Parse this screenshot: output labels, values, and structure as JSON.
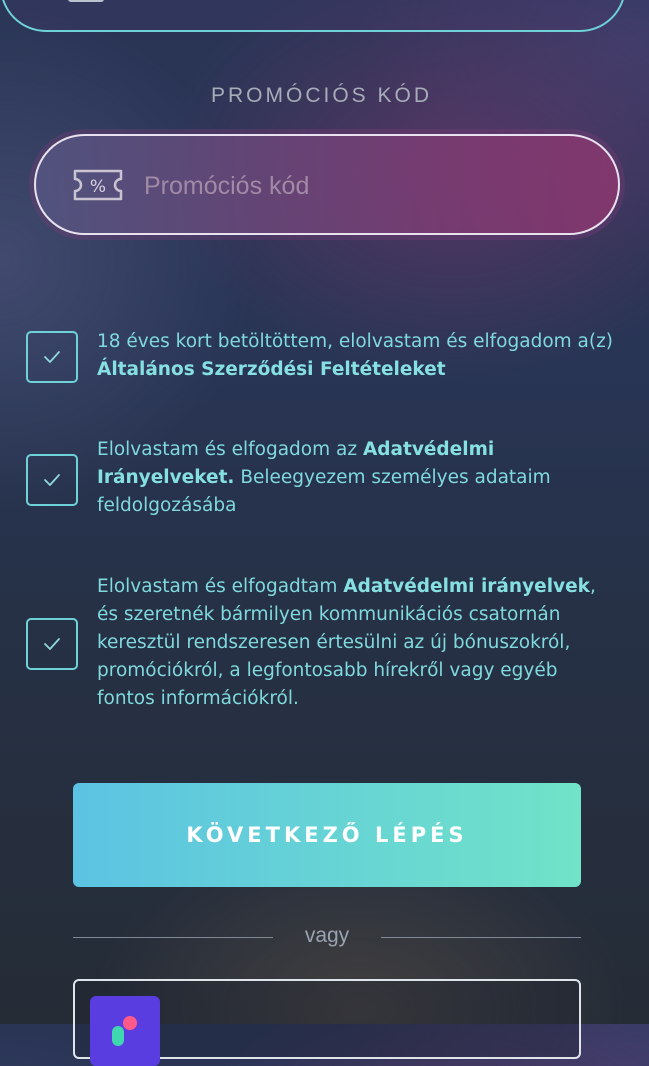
{
  "promo": {
    "section_label": "PROMÓCIÓS KÓD",
    "placeholder": "Promóciós kód",
    "icon": "ticket-percent-icon"
  },
  "consents": [
    {
      "checked": true,
      "text_before": "18 éves kort betöltöttem, elolvastam és elfogadom a(z) ",
      "link": "Általános Szerződési Feltételeket",
      "text_after": ""
    },
    {
      "checked": true,
      "text_before": "Elolvastam és elfogadom az ",
      "link": "Adatvédelmi Irányelveket.",
      "text_after": " Beleegyezem személyes adataim feldolgozásába"
    },
    {
      "checked": true,
      "text_before": "Elolvastam és elfogadtam ",
      "link": "Adatvédelmi irányelvek",
      "text_after": ", és szeretnék bármilyen kommunikációs csatornán keresztül rendszeresen értesülni az új bónuszokról, promóciókról, a legfontosabb hírekről vagy egyéb fontos információkról."
    }
  ],
  "next_button": {
    "label": "KÖVETKEZŐ LÉPÉS"
  },
  "divider": {
    "label": "vagy"
  },
  "colors": {
    "accent": "#6fd2d8",
    "button_gradient_start": "#5cc3e3",
    "button_gradient_end": "#70e3c8",
    "promo_field": "#7d3c73"
  }
}
